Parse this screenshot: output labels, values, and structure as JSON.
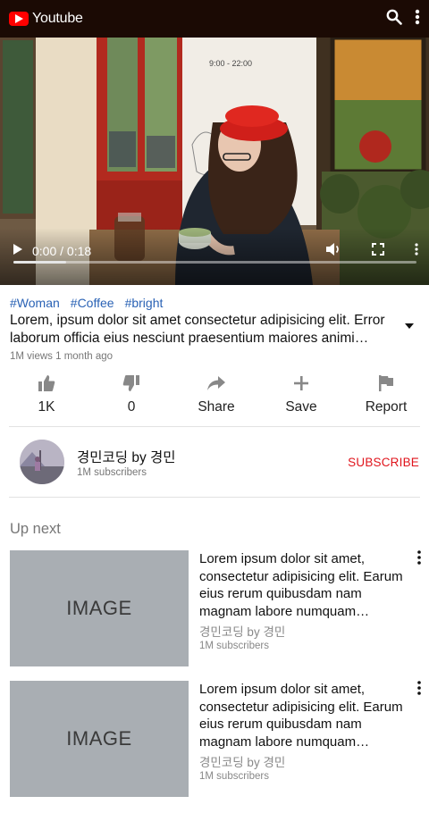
{
  "header": {
    "app_title": "Youtube"
  },
  "video": {
    "time": "0:00 / 0:18",
    "progress": 0.13
  },
  "tags": [
    "#Woman",
    "#Coffee",
    "#bright"
  ],
  "title": "Lorem, ipsum dolor sit amet consectetur adipisicing elit. Error laborum officia eius nesciunt praesentium maiores animi voluptatum",
  "meta": "1M views 1 month ago",
  "actions": [
    {
      "icon": "thumbs-up-icon",
      "label": "1K"
    },
    {
      "icon": "thumbs-down-icon",
      "label": "0"
    },
    {
      "icon": "share-icon",
      "label": "Share"
    },
    {
      "icon": "plus-icon",
      "label": "Save"
    },
    {
      "icon": "flag-icon",
      "label": "Report"
    }
  ],
  "channel": {
    "name": "경민코딩 by 경민",
    "subscribers": "1M subscribers",
    "subscribe_label": "SUBSCRIBE"
  },
  "upnext": {
    "heading": "Up next",
    "items": [
      {
        "thumb_text": "IMAGE",
        "title": "Lorem ipsum dolor sit amet, consectetur adipisicing elit. Earum eius rerum quibusdam nam magnam labore numquam voluptas",
        "channel": "경민코딩 by 경민",
        "subscribers": "1M subscribers"
      },
      {
        "thumb_text": "IMAGE",
        "title": "Lorem ipsum dolor sit amet, consectetur adipisicing elit. Earum eius rerum quibusdam nam magnam labore numquam voluptas",
        "channel": "경민코딩 by 경민",
        "subscribers": "1M subscribers"
      }
    ]
  },
  "colors": {
    "header_bg": "#1b0a04",
    "brand_red": "#ff0000",
    "tag_blue": "#2a62b5",
    "subscribe_red": "#e0141c"
  }
}
